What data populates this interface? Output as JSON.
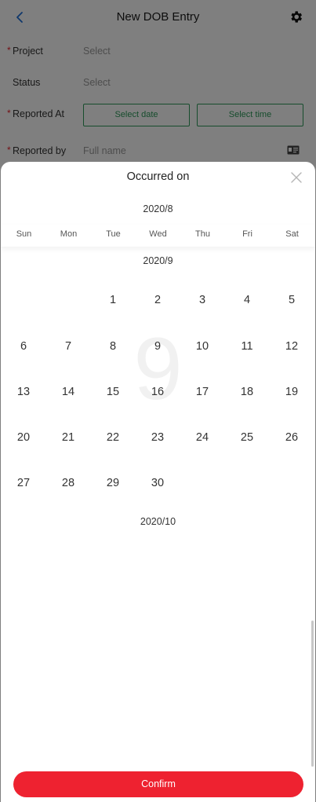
{
  "header": {
    "title": "New DOB Entry"
  },
  "form": {
    "project": {
      "label": "Project",
      "value": "Select",
      "required": true
    },
    "status": {
      "label": "Status",
      "value": "Select",
      "required": false
    },
    "reported_at": {
      "label": "Reported At",
      "date_label": "Select date",
      "time_label": "Select time",
      "required": true
    },
    "reported_by": {
      "label": "Reported by",
      "placeholder": "Full name",
      "required": true
    }
  },
  "calendar": {
    "title": "Occurred on",
    "prev_month": "2020/8",
    "current_month": "2020/9",
    "next_month": "2020/10",
    "watermark": "9",
    "weekdays": [
      "Sun",
      "Mon",
      "Tue",
      "Wed",
      "Thu",
      "Fri",
      "Sat"
    ],
    "first_weekday_index": 2,
    "days": [
      "1",
      "2",
      "3",
      "4",
      "5",
      "6",
      "7",
      "8",
      "9",
      "10",
      "11",
      "12",
      "13",
      "14",
      "15",
      "16",
      "17",
      "18",
      "19",
      "20",
      "21",
      "22",
      "23",
      "24",
      "25",
      "26",
      "27",
      "28",
      "29",
      "30"
    ],
    "confirm_label": "Confirm"
  },
  "colors": {
    "accent_green": "#2e9a5a",
    "required_red": "#e8202a",
    "confirm_red": "#ee2230",
    "back_blue": "#1e6fd9"
  },
  "icons": {
    "back": "chevron-left-icon",
    "settings": "gear-icon",
    "close": "close-icon",
    "contact": "id-card-icon"
  }
}
